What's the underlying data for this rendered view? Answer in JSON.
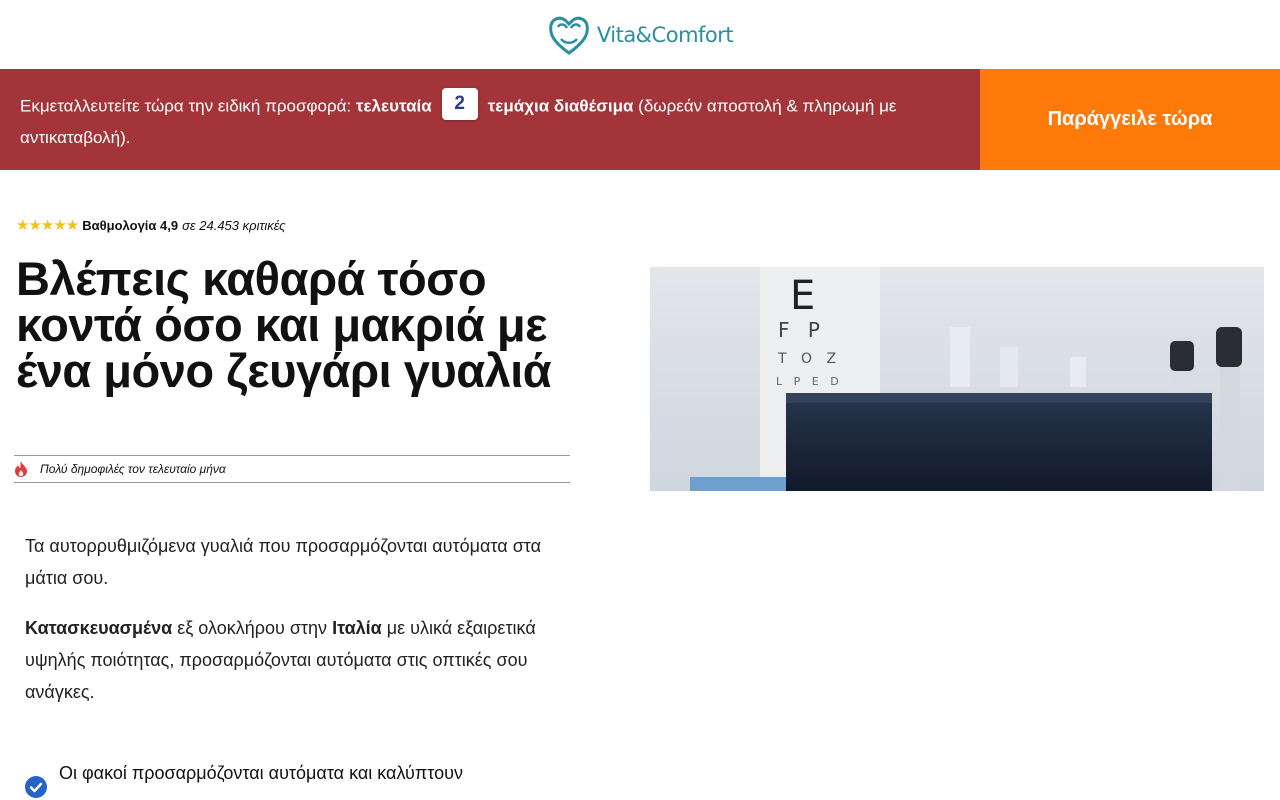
{
  "header": {
    "logo_text": "Vita&Comfort"
  },
  "offer": {
    "text_before": "Εκμεταλλευτείτε τώρα την ειδική προσφορά: ",
    "bold_last": "τελευταία",
    "quantity": "2",
    "bold_pieces": "τεμάχια διαθέσιμα",
    "text_after": " (δωρεάν αποστολή & πληρωμή με αντικαταβολή).",
    "button_label": "Παράγγειλε τώρα"
  },
  "rating": {
    "stars": "★★★★★",
    "label": "Βαθμολογία 4,9",
    "count_text": " σε 24.453 κριτικές"
  },
  "headline": "Βλέπεις καθαρά τόσο κοντά όσο και μακριά με ένα μόνο ζευγάρι γυαλιά",
  "popular_text": "Πολύ δημοφιλές τον τελευταίο μήνα",
  "body": {
    "p1": "Τα αυτορρυθμιζόμενα γυαλιά που προσαρμόζονται αυτόματα στα μάτια σου.",
    "p2_bold1": "Κατασκευασμένα",
    "p2_mid": " εξ ολοκλήρου στην ",
    "p2_bold2": "Ιταλία",
    "p2_end": " με υλικά εξαιρετικά υψηλής ποιότητας, προσαρμόζονται αυτόματα στις οπτικές σου ανάγκες."
  },
  "feature": {
    "text": "Οι φακοί προσαρμόζονται αυτόματα και καλύπτουν"
  },
  "colors": {
    "offer_bg": "#a3353a",
    "order_button": "#ff7a0a",
    "logo": "#2a8f9e",
    "stars": "#f2c21a"
  }
}
